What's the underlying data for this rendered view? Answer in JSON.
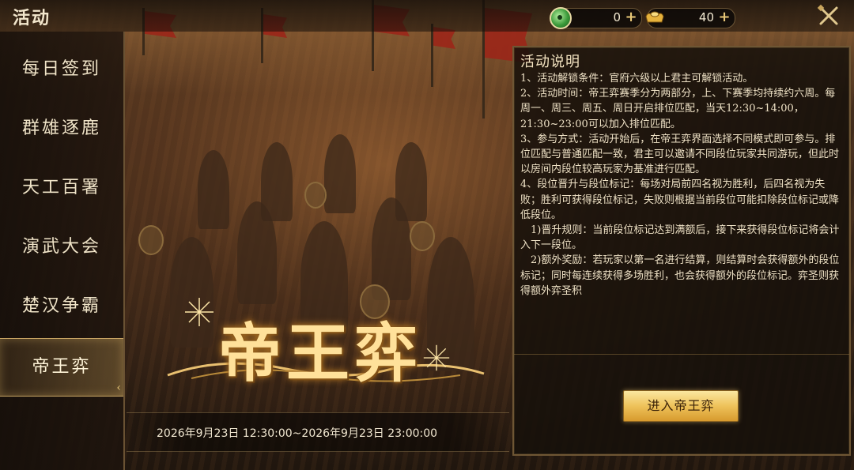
{
  "header": {
    "title": "活动",
    "currency": [
      {
        "icon": "jade-coin-icon",
        "value": "0"
      },
      {
        "icon": "gold-ingot-icon",
        "value": "40"
      }
    ],
    "plus_label": "+"
  },
  "sidebar": {
    "items": [
      {
        "label": "每日签到",
        "active": false
      },
      {
        "label": "群雄逐鹿",
        "active": false
      },
      {
        "label": "天工百署",
        "active": false
      },
      {
        "label": "演武大会",
        "active": false
      },
      {
        "label": "楚汉争霸",
        "active": false
      },
      {
        "label": "帝王弈",
        "active": true
      }
    ],
    "active_arrow": "‹"
  },
  "banner": {
    "logo_text": "帝王弈",
    "date_range": "2026年9月23日 12:30:00~2026年9月23日 23:00:00"
  },
  "panel": {
    "title": "活动说明",
    "paragraphs": [
      "1、活动解锁条件：官府六级以上君主可解锁活动。",
      "2、活动时间：帝王弈赛季分为两部分，上、下赛季均持续约六周。每周一、周三、周五、周日开启排位匹配，当天12:30~14:00，21:30~23:00可以加入排位匹配。",
      "3、参与方式：活动开始后，在帝王弈界面选择不同模式即可参与。排位匹配与普通匹配一致，君主可以邀请不同段位玩家共同游玩，但此时以房间内段位较高玩家为基准进行匹配。",
      "4、段位晋升与段位标记：每场对局前四名视为胜利，后四名视为失败；胜利可获得段位标记，失败则根据当前段位可能扣除段位标记或降低段位。",
      "　1)晋升规则：当前段位标记达到满额后，接下来获得段位标记将会计入下一段位。",
      "　2)额外奖励：若玩家以第一名进行结算，则结算时会获得额外的段位标记；同时每连续获得多场胜利，也会获得额外的段位标记。弈圣则获得额外弈圣积"
    ],
    "enter_button": "进入帝王弈"
  },
  "colors": {
    "accent_gold": "#e8c878",
    "button_gold": "#eec25a",
    "panel_bg": "#16100b",
    "flag_red": "#9e2318"
  }
}
